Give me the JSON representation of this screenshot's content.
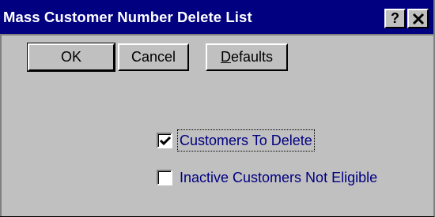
{
  "window": {
    "title": "Mass Customer Number Delete List",
    "help_label": "?",
    "close_label": "✕"
  },
  "buttons": {
    "ok": "OK",
    "cancel": "Cancel",
    "defaults_prefix": "D",
    "defaults_rest": "efaults"
  },
  "options": [
    {
      "label": "Customers To Delete",
      "checked": true
    },
    {
      "label": "Inactive Customers Not Eligible",
      "checked": false
    }
  ]
}
